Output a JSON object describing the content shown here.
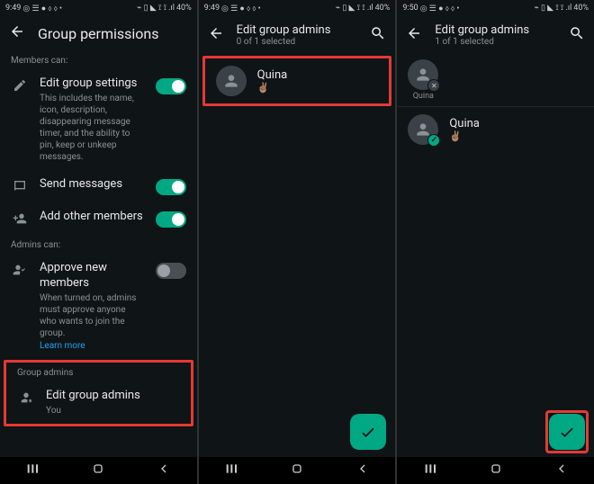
{
  "screen1": {
    "status": {
      "time": "9:49",
      "left_icons": "◎ ☰ ● ⬨ ⬨ •",
      "right_icons": "⌁ ▯ ◣ ⟟ ⟟ .ıl",
      "battery": "40%"
    },
    "title": "Group permissions",
    "members_label": "Members can:",
    "edit_settings": {
      "title": "Edit group settings",
      "desc": "This includes the name, icon, description, disappearing message timer, and the ability to pin, keep or unkeep messages."
    },
    "send_messages": "Send messages",
    "add_members": "Add other members",
    "admins_label": "Admins can:",
    "approve": {
      "title": "Approve new members",
      "desc": "When turned on, admins must approve anyone who wants to join the group.",
      "link": "Learn more"
    },
    "group_admins_label": "Group admins",
    "edit_admins": {
      "title": "Edit group admins",
      "sub": "You"
    }
  },
  "screen2": {
    "status": {
      "time": "9:49",
      "left_icons": "◎ ☰ ● ⬨ ⬨ •",
      "right_icons": "⌁ ▯ ◣ ⟟ ⟟ .ıl",
      "battery": "40%"
    },
    "title": "Edit group admins",
    "subtitle": "0 of 1 selected",
    "contact": {
      "name": "Quina",
      "status": "✌🏽"
    }
  },
  "screen3": {
    "status": {
      "time": "9:50",
      "left_icons": "◎ ☰ ● ⬨ ⬨ •",
      "right_icons": "⌁ ▯ ◣ ⟟ ⟟ .ıl",
      "battery": "40%"
    },
    "title": "Edit group admins",
    "subtitle": "1 of 1 selected",
    "selected_name": "Quina",
    "contact": {
      "name": "Quina",
      "status": "✌🏽"
    }
  }
}
